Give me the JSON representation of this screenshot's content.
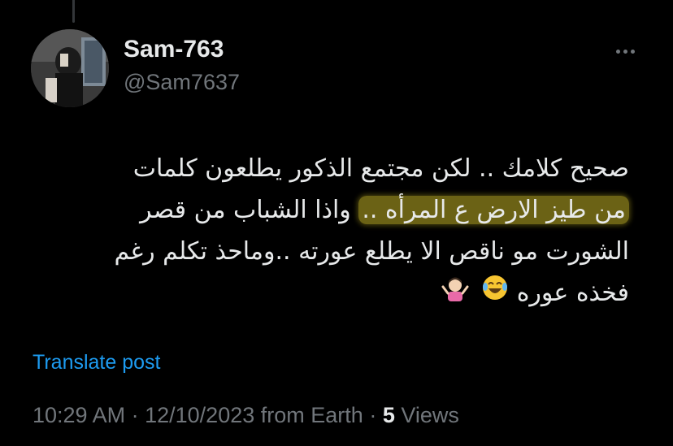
{
  "user": {
    "display_name": "Sam-763",
    "handle": "@Sam7637"
  },
  "tweet": {
    "lines": [
      "صحيح كلامك .. لكن مجتمع الذكور يطلعون كلمات",
      "واذا الشباب من قصر",
      "من طيز الارض ع المرأه ..",
      "الشورت مو ناقص الا يطلع عورته ..وماحذ تكلم رغم",
      "فخذه عوره"
    ],
    "emojis": [
      "laughing-crying-face",
      "person-shrugging"
    ]
  },
  "translate_label": "Translate post",
  "meta": {
    "time": "10:29 AM",
    "date": "12/10/2023",
    "source": "from Earth",
    "separator": "·",
    "views_count": "5",
    "views_label": "Views"
  },
  "colors": {
    "background": "#000000",
    "text": "#e7e9ea",
    "secondary": "#71767b",
    "link": "#1d9bf0",
    "highlight": "#6b6215"
  }
}
